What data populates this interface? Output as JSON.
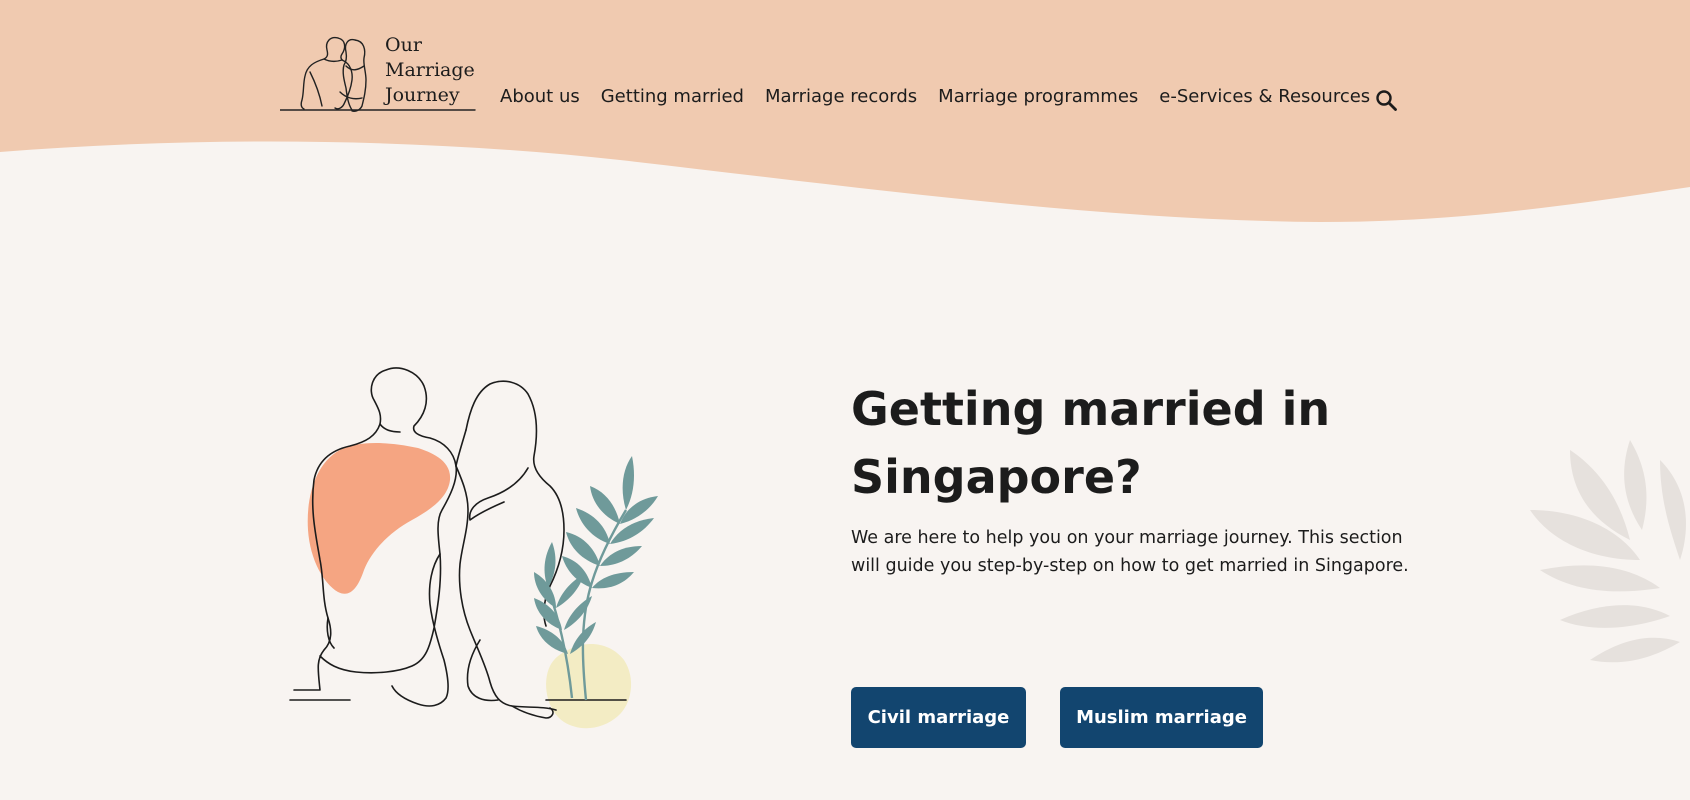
{
  "header": {
    "logo": {
      "line1": "Our",
      "line2": "Marriage",
      "line3": "Journey"
    },
    "nav": [
      "About us",
      "Getting married",
      "Marriage records",
      "Marriage programmes",
      "e-Services & Resources"
    ],
    "search_icon": "search-icon"
  },
  "hero": {
    "title": "Getting married in Singapore?",
    "description": "We are here to help you on your marriage journey. This section will guide you step-by-step on how to get married in Singapore.",
    "buttons": {
      "civil": "Civil marriage",
      "muslim": "Muslim marriage"
    }
  },
  "colors": {
    "header_bg": "#f0cab0",
    "page_bg": "#f8f4f1",
    "button_bg": "#12456f",
    "accent_orange": "#f5a582",
    "leaf_green": "#6f9a9a",
    "accent_yellow": "#f3ecc4"
  }
}
